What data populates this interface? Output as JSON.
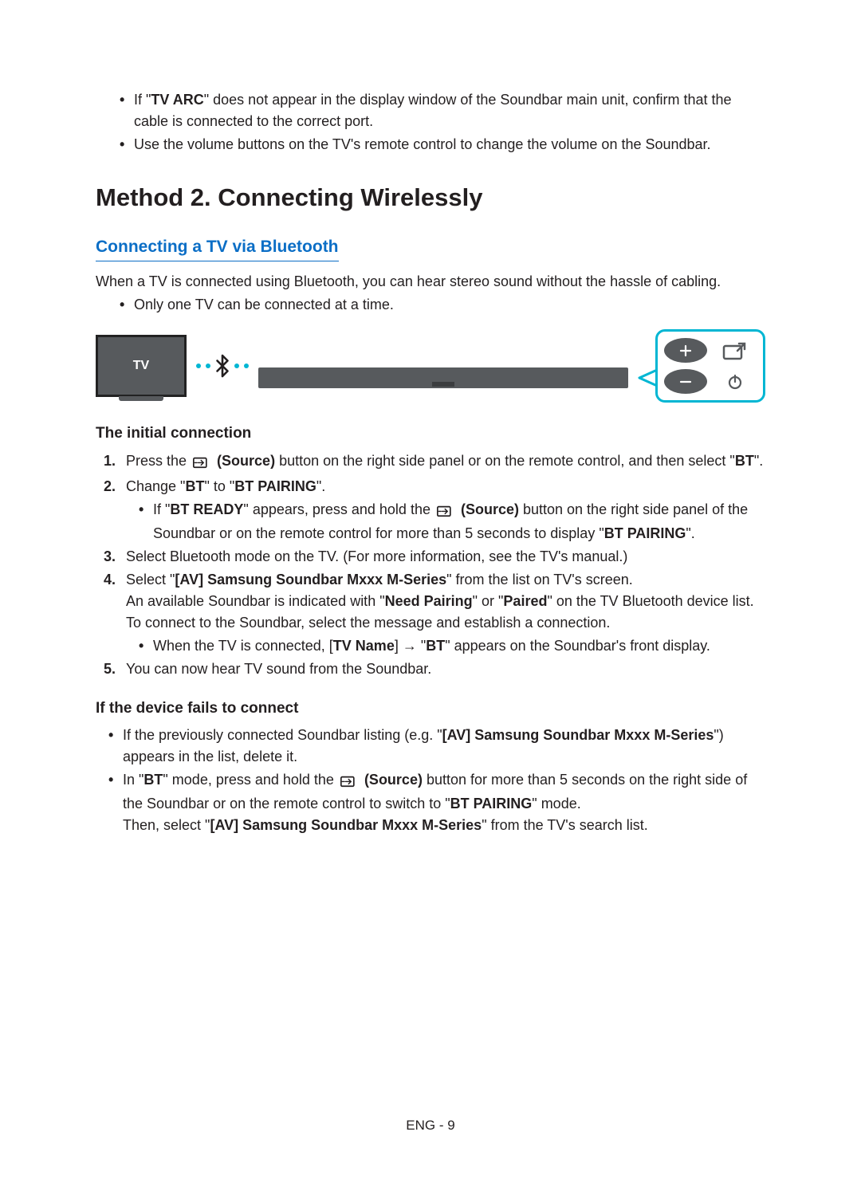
{
  "top_notes": {
    "item1_pre": "If \"",
    "item1_bold": "TV ARC",
    "item1_post": "\" does not appear in the display window of the Soundbar main unit, confirm that the cable is connected to the correct port.",
    "item2": "Use the volume buttons on the TV's remote control to change the volume on the Soundbar."
  },
  "headings": {
    "method2": "Method 2. Connecting Wirelessly",
    "bt_connect": "Connecting a TV via Bluetooth",
    "initial": "The initial connection",
    "fails": "If the device fails to connect"
  },
  "intro": {
    "sentence": "When a TV is connected using Bluetooth, you can hear stereo sound without the hassle of cabling.",
    "bullet": "Only one TV can be connected at a time."
  },
  "diagram": {
    "tv_label": "TV",
    "panel_icons": {
      "plus": "plus-icon",
      "source": "source-icon",
      "minus": "minus-icon",
      "power": "power-icon"
    }
  },
  "steps": {
    "s1_a": "Press the ",
    "source_label": " (Source)",
    "s1_b": " button on the right side panel or on the remote control, and then select \"",
    "bt": "BT",
    "s1_c": "\".",
    "s2_a": "Change \"",
    "s2_b": "\" to \"",
    "bt_pairing": "BT PAIRING",
    "s2_c": "\".",
    "s2_sub_a": "If \"",
    "bt_ready": "BT READY",
    "s2_sub_b": "\" appears, press and hold the ",
    "s2_sub_c": " button on the right side panel of the Soundbar or on the remote control for more than 5 seconds to display \"",
    "s2_sub_d": "\".",
    "s3": "Select Bluetooth mode on the TV. (For more information, see the TV's manual.)",
    "s4_a": "Select \"",
    "av_name": "[AV] Samsung Soundbar Mxxx M-Series",
    "s4_b": "\" from the list on TV's screen.",
    "s4_line2_a": "An available Soundbar is indicated with \"",
    "need_pairing": "Need Pairing",
    "s4_line2_b": "\" or \"",
    "paired": "Paired",
    "s4_line2_c": "\" on the TV Bluetooth device list. To connect to the Soundbar, select the message and establish a connection.",
    "s4_sub_a": "When the TV is connected, [",
    "tv_name": "TV Name",
    "s4_sub_b": "] → \"",
    "s4_sub_c": "\" appears on the Soundbar's front display.",
    "s5": "You can now hear TV sound from the Soundbar."
  },
  "fails": {
    "b1_a": "If the previously connected Soundbar listing (e.g. \"",
    "b1_b": "\") appears in the list, delete it.",
    "b2_a": "In \"",
    "b2_b": "\" mode, press and hold the ",
    "b2_c": " button for more than 5 seconds on the right side of the Soundbar or on the remote control to switch to \"",
    "b2_d": "\" mode.",
    "b2_line2_a": "Then, select \"",
    "b2_line2_b": "\" from the TV's search list."
  },
  "footer": "ENG - 9"
}
